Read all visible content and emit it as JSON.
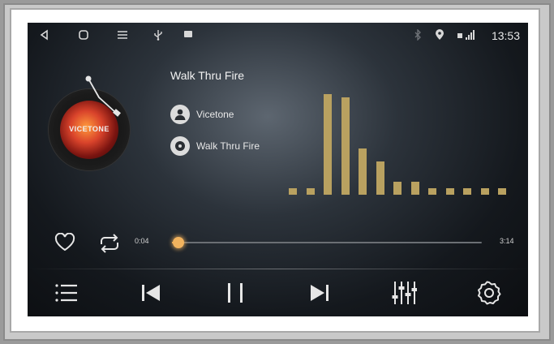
{
  "status_bar": {
    "time": "13:53",
    "left_icons": [
      "back-icon",
      "home-icon",
      "menu-icon",
      "usb-icon",
      "notification-icon"
    ],
    "right_icons": [
      "bluetooth-icon",
      "location-icon",
      "signal-icon"
    ]
  },
  "track": {
    "title": "Walk Thru Fire",
    "artist": "Vicetone",
    "album": "Walk Thru Fire",
    "album_art_text": "VICETONE"
  },
  "progress": {
    "elapsed": "0:04",
    "total": "3:14",
    "fraction": 0.02
  },
  "equalizer": {
    "levels": [
      0.06,
      0.06,
      0.94,
      0.91,
      0.43,
      0.31,
      0.12,
      0.12,
      0.06,
      0.06,
      0.06,
      0.06,
      0.06
    ],
    "color": "#b9a160"
  },
  "controls": {
    "favorite": "heart-icon",
    "repeat": "repeat-icon",
    "playlist": "playlist-icon",
    "previous": "previous-icon",
    "play_pause": "pause-icon",
    "next": "next-icon",
    "equalizer": "equalizer-icon",
    "settings": "settings-icon"
  },
  "colors": {
    "accent": "#f2b35e",
    "eq_bar": "#b9a160",
    "text": "#f2f2f2"
  }
}
